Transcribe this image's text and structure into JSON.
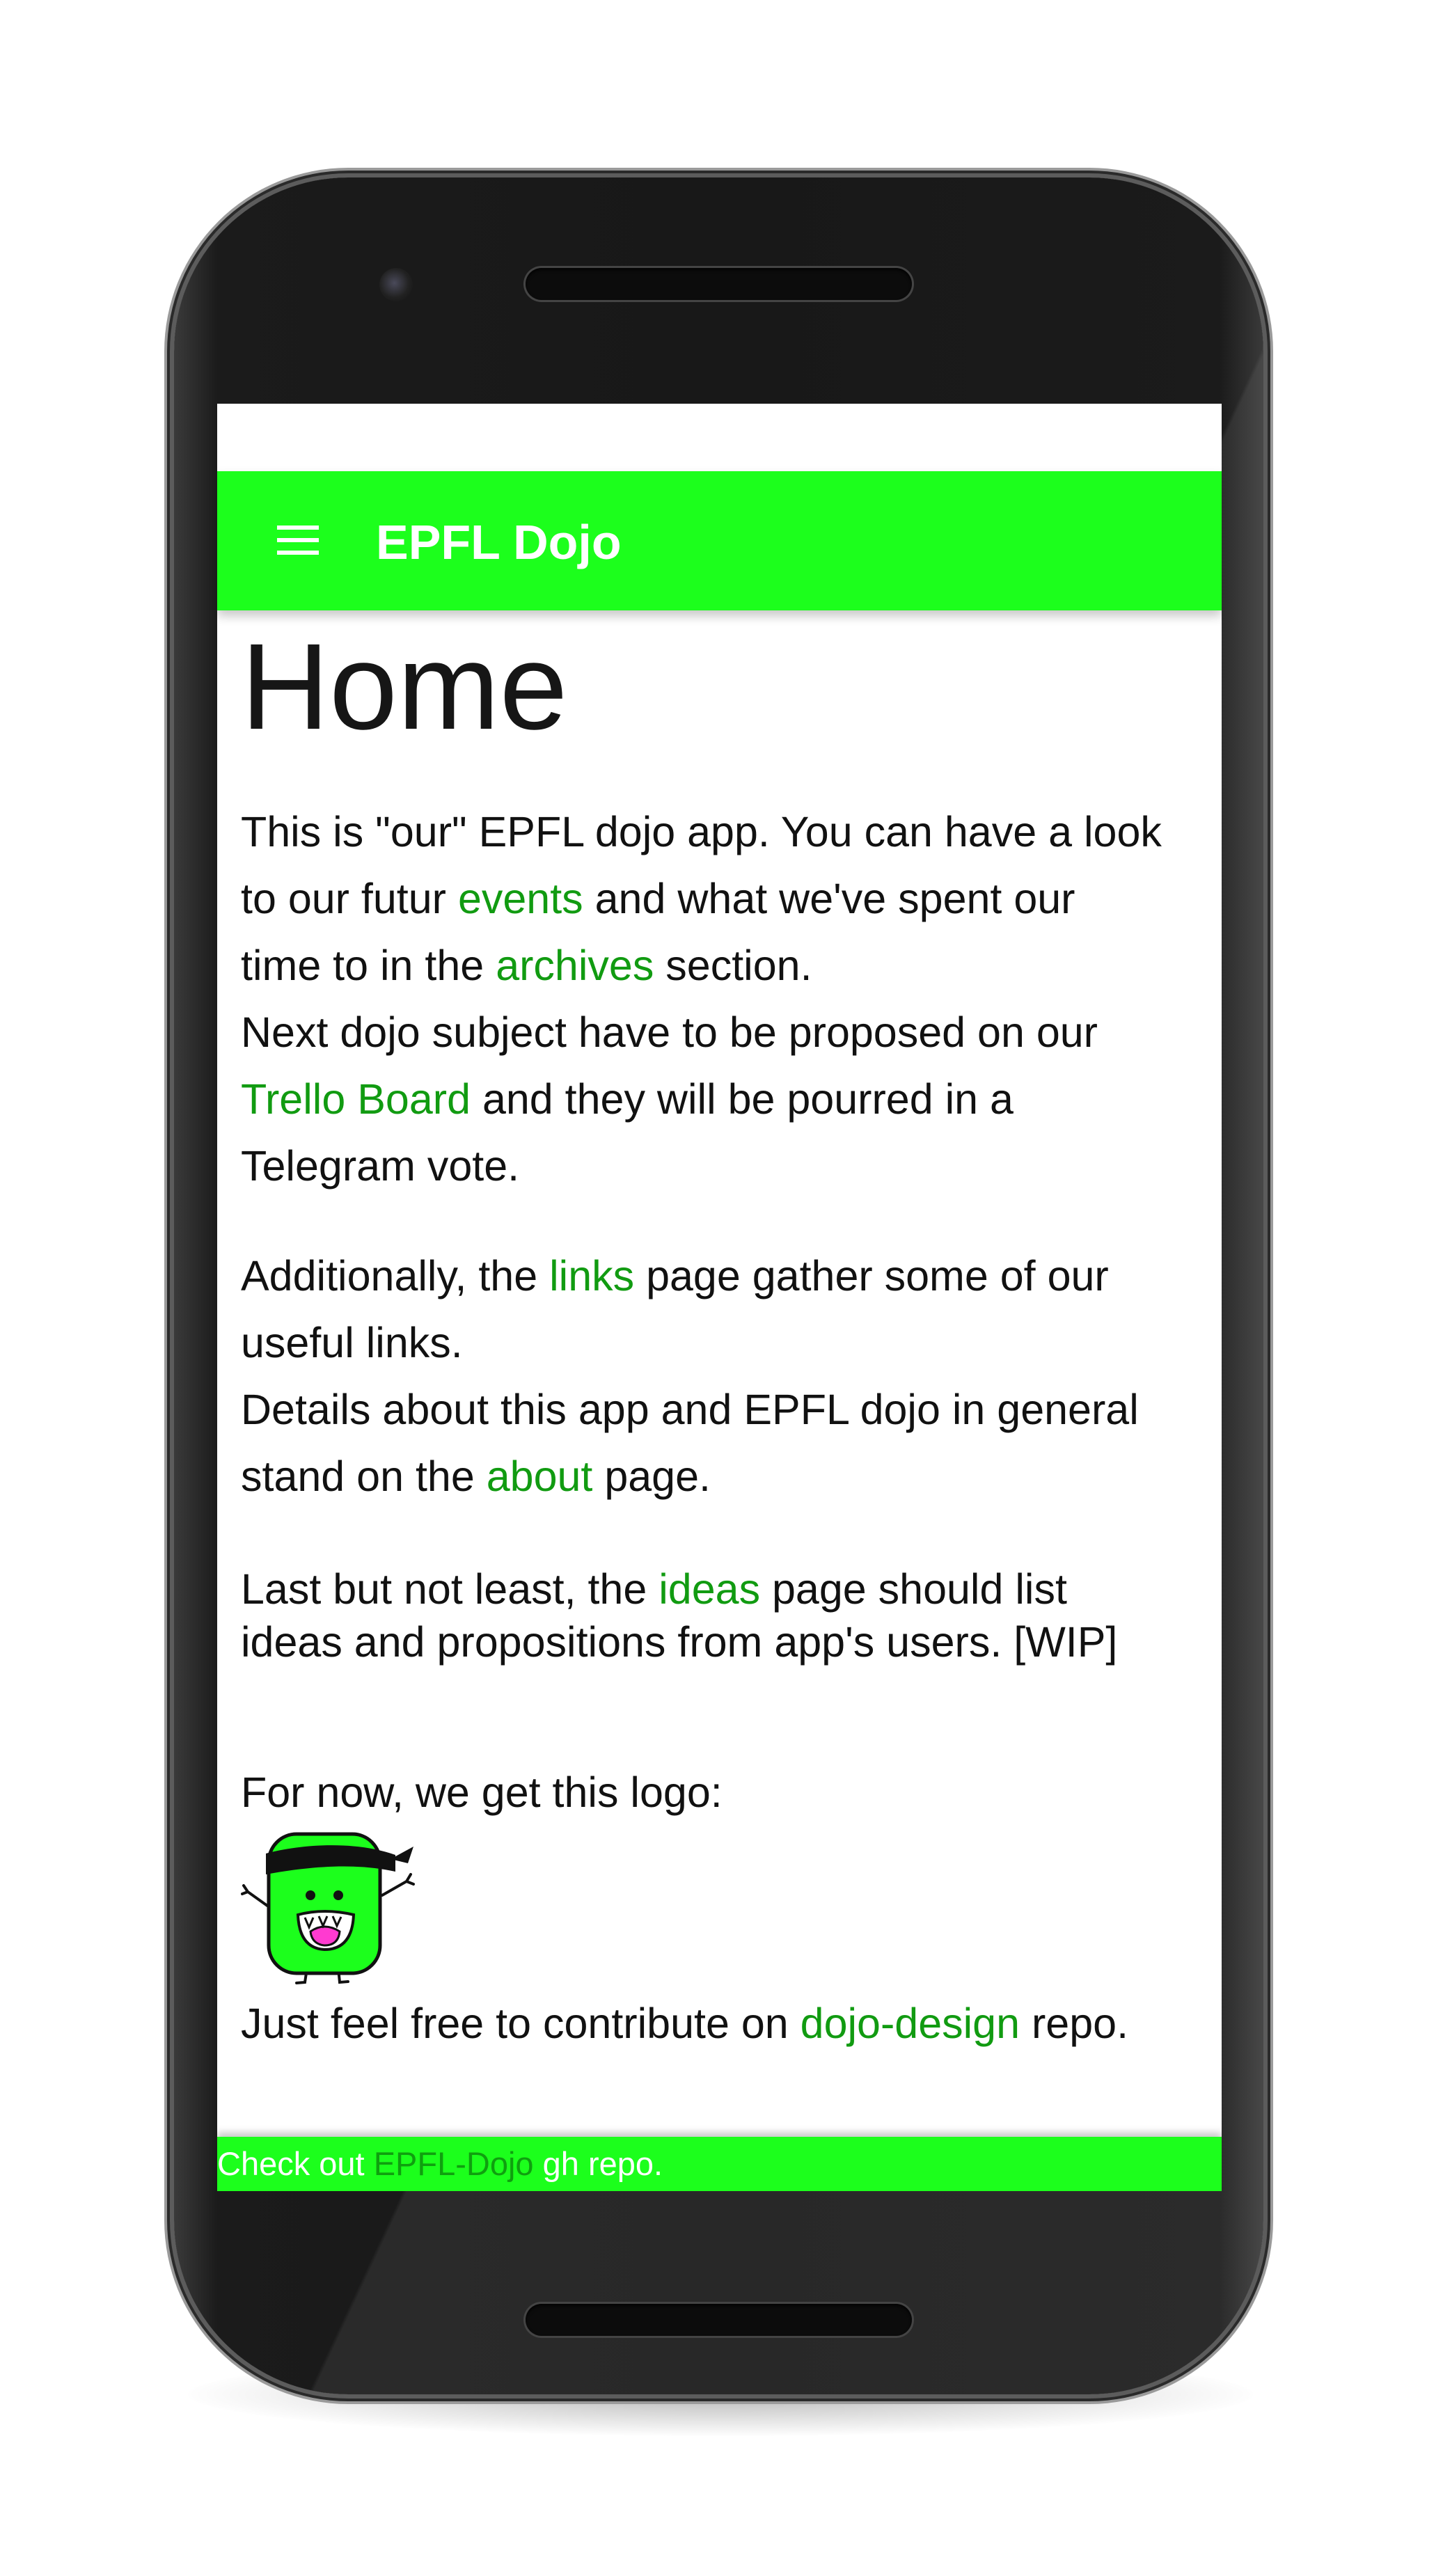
{
  "app": {
    "title": "EPFL Dojo",
    "accent_color": "#1cff1c",
    "link_color": "#119b11",
    "menu_icon": "hamburger-menu-icon"
  },
  "page": {
    "title": "Home",
    "p1": {
      "t1": "This is \"our\" EPFL dojo app. You can have a look",
      "t2": "to our futur ",
      "link_events": "events",
      "t3": " and what we've spent our",
      "t4": "time to in the ",
      "link_archives": "archives",
      "t5": " section.",
      "t6": "Next dojo subject have to be proposed on our",
      "link_trello": "Trello Board",
      "t7": " and they will be pourred in a",
      "t8": "Telegram vote."
    },
    "p2": {
      "t1": "Additionally, the ",
      "link_links": "links",
      "t2": " page gather some of our",
      "t3": "useful links.",
      "t4": "Details about this app and EPFL dojo in general",
      "t5": "stand on the ",
      "link_about": "about",
      "t6": " page."
    },
    "p3": {
      "t1": "Last but not least, the ",
      "link_ideas": "ideas",
      "t2": " page should list",
      "t3": "ideas and propositions from app's users. [WIP]"
    },
    "p4": {
      "t1": "For now, we get this logo:"
    },
    "logo": {
      "icon": "dojo-mascot-logo"
    },
    "p5": {
      "t1": "Just feel free to contribute on ",
      "link_design": "dojo-design",
      "t2": " repo."
    }
  },
  "footer": {
    "t1": "Check out ",
    "link_repo": "EPFL-Dojo",
    "t2": " gh repo."
  }
}
